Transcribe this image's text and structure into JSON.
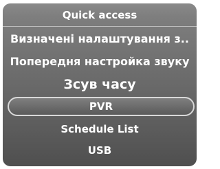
{
  "menu": {
    "title": "Quick access",
    "items": [
      {
        "label": "Визначені налаштування з..",
        "selected": false
      },
      {
        "label": "Попередня настройка звуку",
        "selected": false
      },
      {
        "label": "Зсув часу",
        "selected": false
      },
      {
        "label": "PVR",
        "selected": true
      },
      {
        "label": "Schedule List",
        "selected": false
      },
      {
        "label": "USB",
        "selected": false
      }
    ]
  },
  "colors": {
    "panel_top": "#8a8a8a",
    "panel_bottom": "#4f4f4f",
    "text": "#ffffff",
    "highlight_border": "#d9d9d9"
  }
}
